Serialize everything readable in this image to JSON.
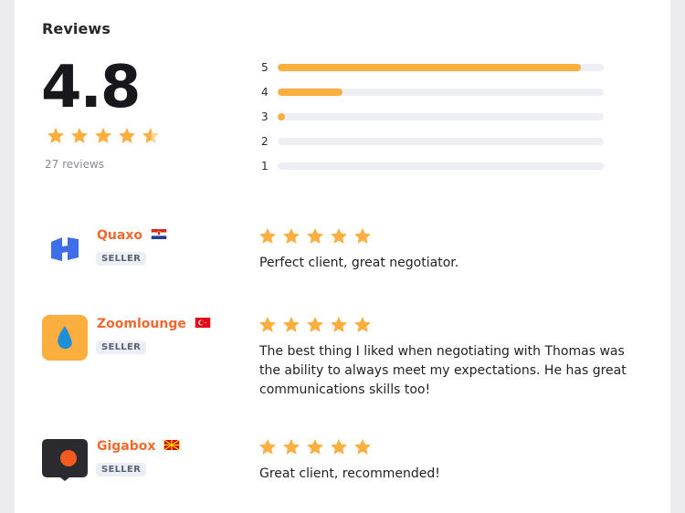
{
  "reviews_section": {
    "title": "Reviews",
    "average_score": "4.8",
    "average_rating": 4.8,
    "review_count_text": "27 reviews",
    "star_color": "#FCAE3F",
    "distribution": [
      {
        "label": "5",
        "fraction": 0.93
      },
      {
        "label": "4",
        "fraction": 0.2
      },
      {
        "label": "3",
        "fraction": 0.02
      },
      {
        "label": "2",
        "fraction": 0
      },
      {
        "label": "1",
        "fraction": 0
      }
    ]
  },
  "reviews": [
    {
      "company": "Quaxo",
      "flag_icon": "croatia-flag-icon",
      "logo_icon": "quaxo-logo-icon",
      "tag": "SELLER",
      "rating": 5,
      "text": "Perfect client, great negotiator."
    },
    {
      "company": "Zoomlounge",
      "flag_icon": "turkey-flag-icon",
      "logo_icon": "zoomlounge-logo-icon",
      "tag": "SELLER",
      "rating": 5,
      "text": "The best thing I liked when negotiating with Thomas was the ability to always meet my expectations. He has great communications skills too!"
    },
    {
      "company": "Gigabox",
      "flag_icon": "north-macedonia-flag-icon",
      "logo_icon": "gigabox-logo-icon",
      "tag": "SELLER",
      "rating": 5,
      "text": "Great client, recommended!"
    }
  ]
}
